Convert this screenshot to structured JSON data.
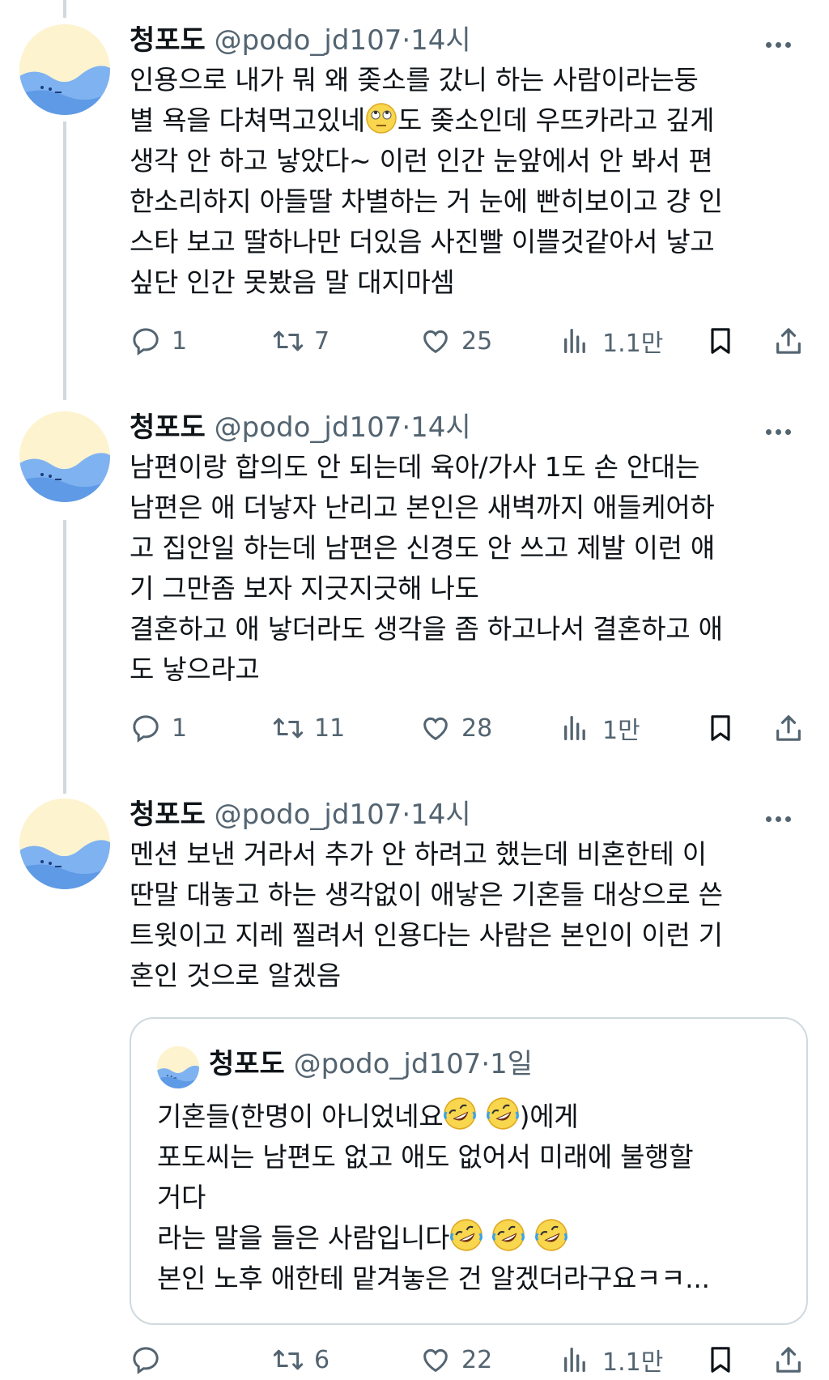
{
  "tweets": [
    {
      "name": "청포도",
      "handle": "@podo_jd107",
      "dot": "·",
      "time": "14시",
      "body": "인용으로 내가 뭐 왜 좆소를 갔니 하는 사람이라는둥\n별 욕을 다쳐먹고있네",
      "body_emoji": "eye-roll-emoji",
      "body_rest": "도 좆소인데 우뜨카라고 깊게\n생각 안 하고 낳았다~ 이런 인간 눈앞에서 안 봐서 편\n한소리하지 아들딸 차별하는 거 눈에 빤히보이고 걍 인\n스타 보고 딸하나만 더있음 사진빨 이쁠것같아서 낳고\n싶단 인간 못봤음 말 대지마셈",
      "replies": "1",
      "retweets": "7",
      "likes": "25",
      "views": "1.1만"
    },
    {
      "name": "청포도",
      "handle": "@podo_jd107",
      "dot": "·",
      "time": "14시",
      "body": "남편이랑 합의도 안 되는데 육아/가사 1도 손 안대는\n남편은 애 더낳자 난리고 본인은 새벽까지 애들케어하\n고 집안일 하는데 남편은 신경도 안 쓰고 제발 이런 얘\n기 그만좀 보자 지긋지긋해 나도\n결혼하고 애 낳더라도 생각을 좀 하고나서 결혼하고 애\n도 낳으라고",
      "replies": "1",
      "retweets": "11",
      "likes": "28",
      "views": "1만"
    },
    {
      "name": "청포도",
      "handle": "@podo_jd107",
      "dot": "·",
      "time": "14시",
      "body": "멘션 보낸 거라서 추가 안 하려고 했는데 비혼한테 이\n딴말 대놓고 하는 생각없이 애낳은 기혼들 대상으로 쓴\n트윗이고 지레 찔려서 인용다는 사람은 본인이 이런 기\n혼인 것으로 알겠음",
      "replies": "",
      "retweets": "6",
      "likes": "22",
      "views": "1.1만",
      "quote": {
        "name": "청포도",
        "handle": "@podo_jd107",
        "dot": "·",
        "time": "1일",
        "line1": "기혼들(한명이 아니었네요",
        "line1_end": ")에게",
        "line2": "포도씨는 남편도 없고 애도 없어서 미래에 불행할\n거다",
        "line3": "라는 말을 들은 사람입니다",
        "line4": "본인 노후 애한테 맡겨놓은 건 알겠더라구요ㅋㅋ...",
        "emoji": "rolling-on-floor-laughing-emoji"
      }
    }
  ],
  "icons": {
    "reply": "speech-bubble-icon",
    "retweet": "retweet-icon",
    "like": "heart-icon",
    "views": "bar-chart-icon",
    "bookmark": "bookmark-icon",
    "share": "share-icon",
    "more": "more-dots-icon"
  },
  "colors": {
    "text": "#0f1419",
    "secondary": "#536471",
    "border": "#cfd9de",
    "avatar_bg": "#fdf3cf",
    "avatar_blue": "#7fb2f0"
  }
}
